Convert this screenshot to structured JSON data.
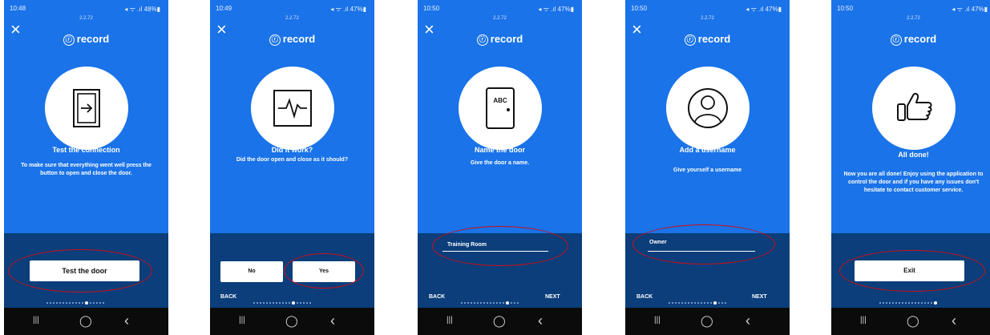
{
  "brand": {
    "logo_text": "record",
    "logo_mark": "ⓡ"
  },
  "version": "2.2.72",
  "icons": {
    "close": "close-icon",
    "recent_apps": "recent-apps-icon",
    "home": "home-icon",
    "back": "back-icon"
  },
  "android_nav": {
    "recents": "|||",
    "home": "◯",
    "back": "‹"
  },
  "colors": {
    "primary": "#1a73e8",
    "dark": "#0b3e7a",
    "highlight": "#c8101b"
  },
  "screens": [
    {
      "status_time": "10:48",
      "status_right": "◂ ᯤ .ıl 48%▮",
      "icon": "door-exit-icon",
      "title": "Test the connection",
      "subtitle": "To make sure that everything went well press the button to open and close the door.",
      "button": "Test the door"
    },
    {
      "status_time": "10:49",
      "status_right": "◂ ᯤ .ıl 47%▮",
      "icon": "heartbeat-icon",
      "title": "Did it work?",
      "subtitle": "Did the door open and close as it should?",
      "no_label": "No",
      "yes_label": "Yes",
      "back_label": "BACK"
    },
    {
      "status_time": "10:50",
      "status_right": "◂ ᯤ .ıl 47%▮",
      "icon": "door-icon",
      "door_label": "ABC",
      "title": "Name the door",
      "subtitle": "Give the door a name.",
      "field_value": "Training Room",
      "back_label": "BACK",
      "next_label": "NEXT"
    },
    {
      "status_time": "10:50",
      "status_right": "◂ ᯤ .ıl 47%▮",
      "icon": "user-icon",
      "title": "Add a username",
      "subtitle": "Give yourself a username",
      "field_value": "Owner",
      "back_label": "BACK",
      "next_label": "NEXT"
    },
    {
      "status_time": "10:50",
      "status_right": "◂ ᯤ .ıl 47%▮",
      "icon": "thumbs-up-icon",
      "title": "All done!",
      "subtitle": "Now you are all done! Enjoy using the application to control the door and if you have any issues don't hesitate to contact customer service.",
      "button": "Exit"
    }
  ]
}
